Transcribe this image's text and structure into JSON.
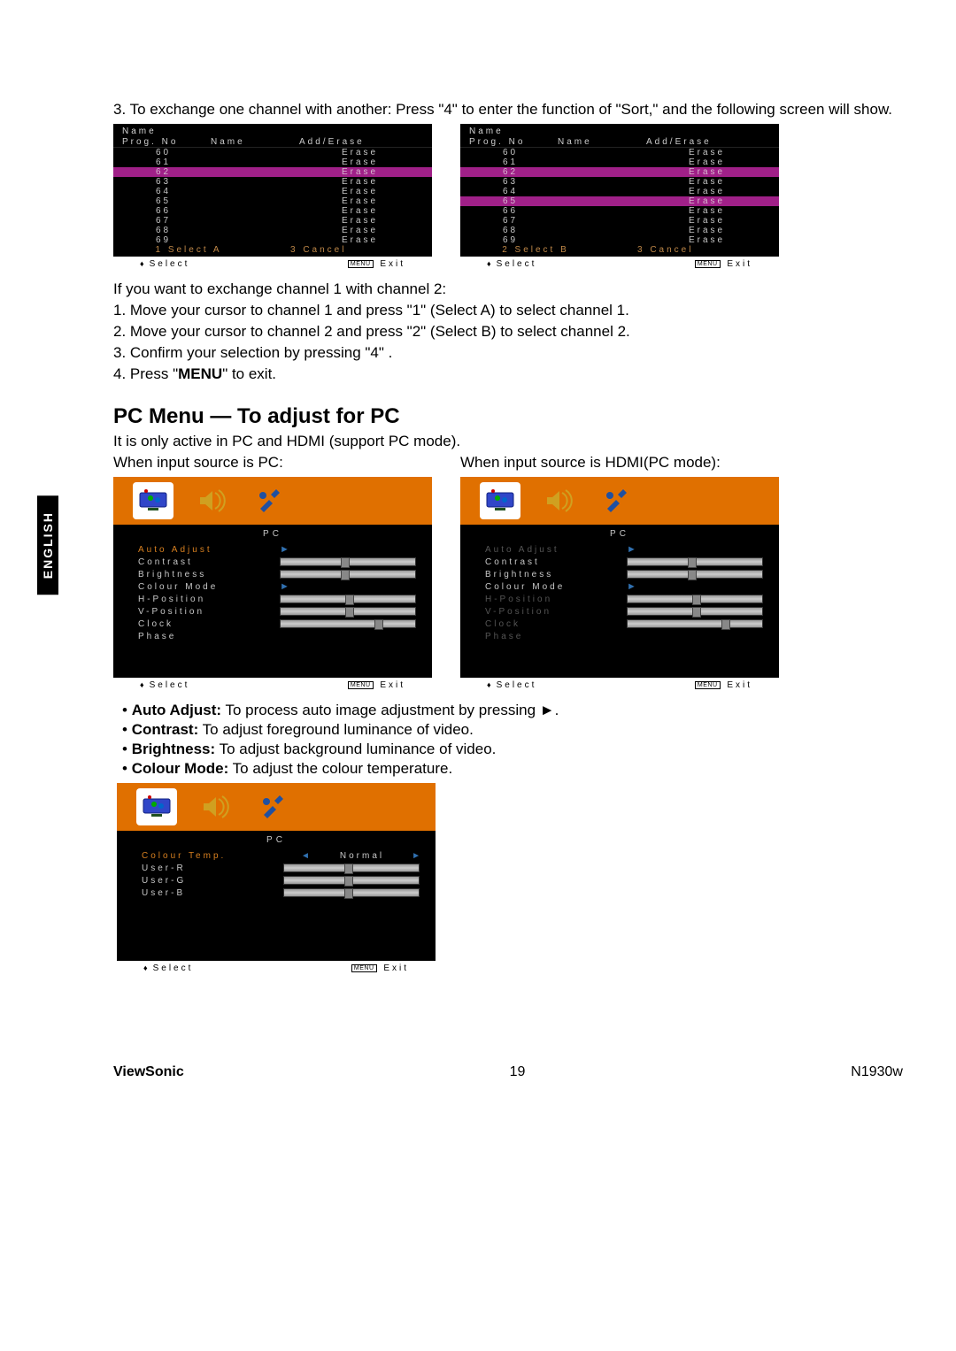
{
  "side_tab": "ENGLISH",
  "intro": "3. To exchange one channel with another: Press \"4\" to enter the function of \"Sort,\" and the following screen will show.",
  "sort_title": "Name",
  "sort_headers": {
    "c1": "Prog. No",
    "c2": "Name",
    "c3": "Add/Erase"
  },
  "sort_rows": [
    {
      "no": "60",
      "action": "Erase"
    },
    {
      "no": "61",
      "action": "Erase"
    },
    {
      "no": "62",
      "action": "Erase"
    },
    {
      "no": "63",
      "action": "Erase"
    },
    {
      "no": "64",
      "action": "Erase"
    },
    {
      "no": "65",
      "action": "Erase"
    },
    {
      "no": "66",
      "action": "Erase"
    },
    {
      "no": "67",
      "action": "Erase"
    },
    {
      "no": "68",
      "action": "Erase"
    },
    {
      "no": "69",
      "action": "Erase"
    }
  ],
  "sort_left": {
    "sel": "1 Select A",
    "cancel": "3 Cancel",
    "highlight": [
      2
    ]
  },
  "sort_right": {
    "sel": "2 Select B",
    "cancel": "3 Cancel",
    "highlight": [
      2,
      5
    ]
  },
  "foot_select": "Select",
  "foot_menu": "MENU",
  "foot_exit": "Exit",
  "exchange_intro": "If you want to exchange channel 1 with channel 2:",
  "exchange_steps": [
    "1. Move your cursor to channel 1 and press \"1\" (Select A) to select channel 1.",
    "2. Move your cursor to channel 2 and press \"2\" (Select B) to select channel 2.",
    "3. Confirm your selection by pressing \"4\" .",
    "4. Press \"MENU\" to exit."
  ],
  "exchange_step4_prefix": "4. Press \"",
  "exchange_step4_bold": "MENU",
  "exchange_step4_suffix": "\" to exit.",
  "pc_heading": "PC Menu — To adjust for PC",
  "pc_intro": "It is only active in PC and HDMI (support PC mode).",
  "pc_cap_left": "When input source is PC:",
  "pc_cap_right": "When input source is HDMI(PC mode):",
  "pc_title": "PC",
  "pc_options": [
    {
      "label": "Auto Adjust",
      "type": "arrow",
      "sel": true
    },
    {
      "label": "Contrast",
      "type": "slider",
      "pos": 45
    },
    {
      "label": "Brightness",
      "type": "slider",
      "pos": 45
    },
    {
      "label": "Colour Mode",
      "type": "arrow"
    },
    {
      "label": "H-Position",
      "type": "slider",
      "pos": 48
    },
    {
      "label": "V-Position",
      "type": "slider",
      "pos": 48
    },
    {
      "label": "Clock",
      "type": "slider",
      "pos": 70
    },
    {
      "label": "Phase",
      "type": "none"
    }
  ],
  "pc_options_hdmi_dim": [
    "Auto Adjust",
    "H-Position",
    "V-Position",
    "Clock",
    "Phase"
  ],
  "bullets": [
    {
      "b": "Auto Adjust:",
      "t": " To process auto image adjustment by pressing ►."
    },
    {
      "b": "Contrast:",
      "t": " To adjust foreground luminance of video."
    },
    {
      "b": "Brightness:",
      "t": " To adjust background luminance of video."
    },
    {
      "b": "Colour Mode:",
      "t": " To adjust the colour temperature."
    }
  ],
  "colour_menu": {
    "rows": [
      {
        "label": "Colour Temp.",
        "type": "value",
        "value": "Normal",
        "sel": true
      },
      {
        "label": "User-R",
        "type": "slider",
        "pos": 45
      },
      {
        "label": "User-G",
        "type": "slider",
        "pos": 45
      },
      {
        "label": "User-B",
        "type": "slider",
        "pos": 45
      }
    ]
  },
  "footer": {
    "brand": "ViewSonic",
    "page": "19",
    "model": "N1930w"
  }
}
